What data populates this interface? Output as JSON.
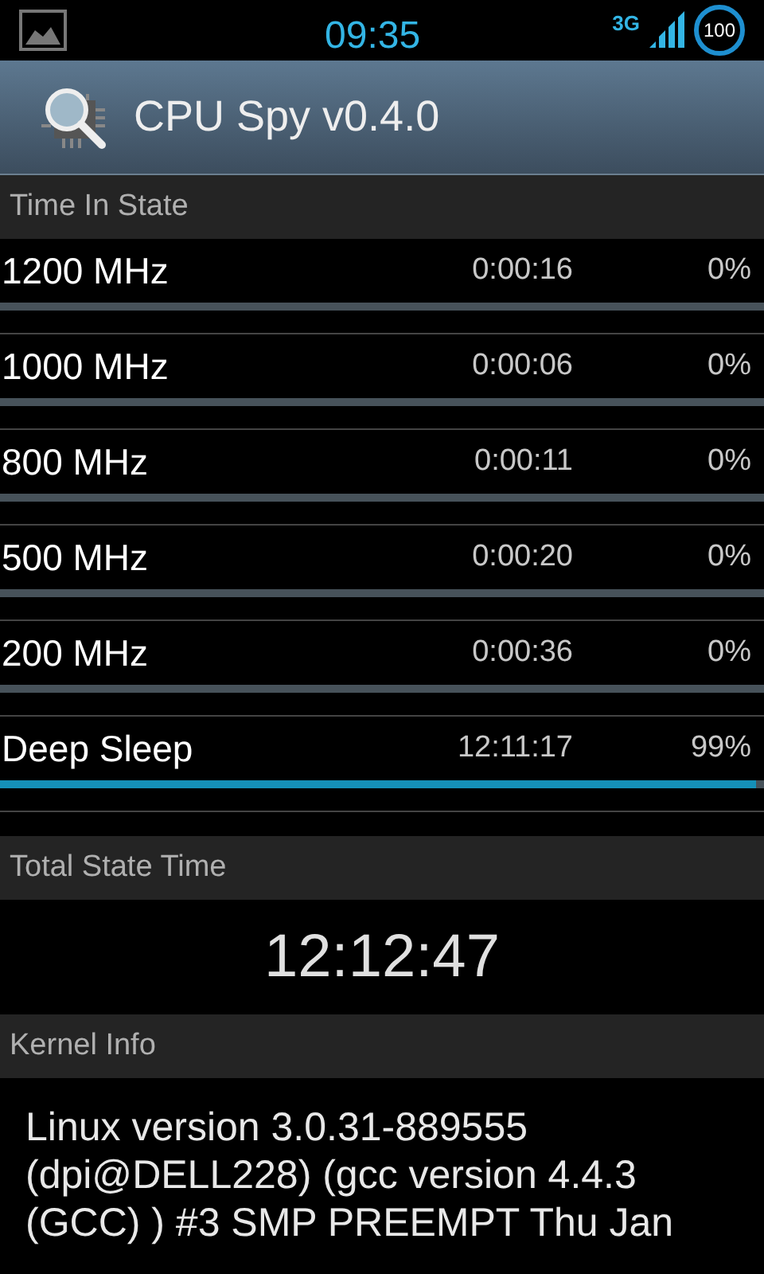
{
  "status_bar": {
    "time": "09:35",
    "network": "3G",
    "battery": "100"
  },
  "action_bar": {
    "title": "CPU Spy v0.4.0"
  },
  "time_in_state": {
    "header": "Time In State",
    "states": [
      {
        "name": "1200 MHz",
        "time": "0:00:16",
        "percent": "0%"
      },
      {
        "name": "1000 MHz",
        "time": "0:00:06",
        "percent": "0%"
      },
      {
        "name": "800 MHz",
        "time": "0:00:11",
        "percent": "0%"
      },
      {
        "name": "500 MHz",
        "time": "0:00:20",
        "percent": "0%"
      },
      {
        "name": "200 MHz",
        "time": "0:00:36",
        "percent": "0%"
      },
      {
        "name": "Deep Sleep",
        "time": "12:11:17",
        "percent": "99%",
        "level": 0.99
      }
    ]
  },
  "total_state_time": {
    "header": "Total State Time",
    "value": "12:12:47"
  },
  "kernel_info": {
    "header": "Kernel Info",
    "lines": [
      "Linux version 3.0.31-889555",
      "(dpi@DELL228) (gcc version 4.4.3",
      "(GCC) ) #3 SMP PREEMPT Thu Jan"
    ]
  }
}
